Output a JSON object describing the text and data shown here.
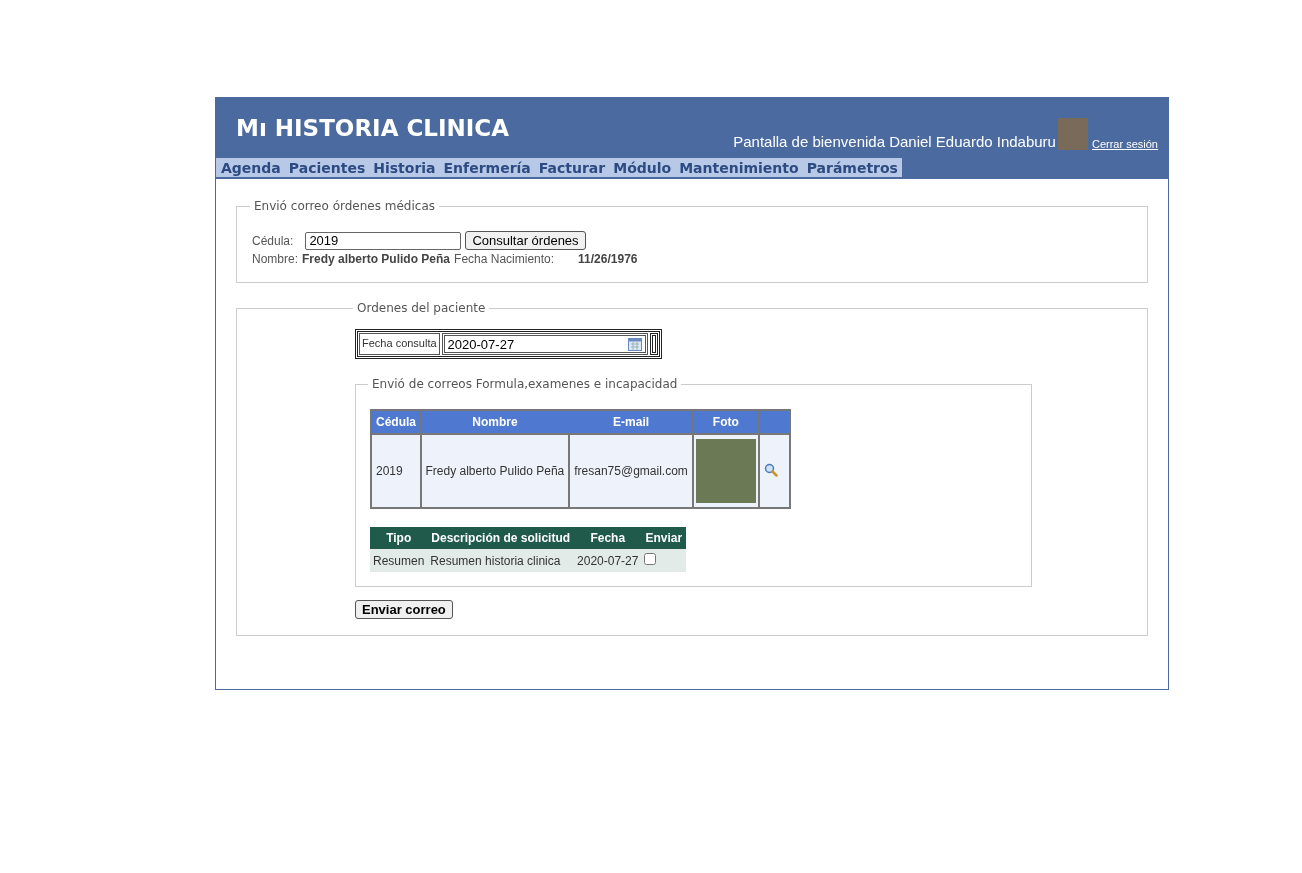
{
  "header": {
    "title": "Mı HISTORIA CLINICA",
    "welcome": "Pantalla de bienvenida Daniel Eduardo Indaburu",
    "logout": "Cerrar sesión"
  },
  "nav": [
    {
      "label": "Agenda"
    },
    {
      "label": "Pacientes"
    },
    {
      "label": "Historia"
    },
    {
      "label": "Enfermería"
    },
    {
      "label": "Facturar"
    },
    {
      "label": "Módulo"
    },
    {
      "label": "Mantenimiento"
    },
    {
      "label": "Parámetros"
    }
  ],
  "search_section": {
    "legend": "Envió correo órdenes médicas",
    "cedula_label": "Cédula:",
    "cedula_value": "2019",
    "search_button": "Consultar órdenes",
    "name_label": "Nombre:",
    "name_value": "Fredy alberto Pulido Peña",
    "birth_label": "Fecha Nacimiento:",
    "birth_value": "11/26/1976"
  },
  "orders_section": {
    "legend": "Ordenes del paciente",
    "date_label": "Fecha consulta",
    "date_value": "2020-07-27",
    "mail_section": {
      "legend": "Envió de correos Formula,examenes e incapacidad",
      "patients_table": {
        "columns": [
          "Cédula",
          "Nombre",
          "E-mail",
          "Foto",
          ""
        ],
        "rows": [
          {
            "cedula": "2019",
            "nombre": "Fredy alberto Pulido Peña",
            "email": "fresan75@gmail.com"
          }
        ]
      },
      "requests_table": {
        "columns": [
          "Tipo",
          "Descripción de solicitud",
          "Fecha",
          "Enviar"
        ],
        "rows": [
          {
            "tipo": "Resumen",
            "descripcion": "Resumen historia clinica",
            "fecha": "2020-07-27",
            "checked": false
          }
        ]
      }
    },
    "send_button": "Enviar correo"
  }
}
